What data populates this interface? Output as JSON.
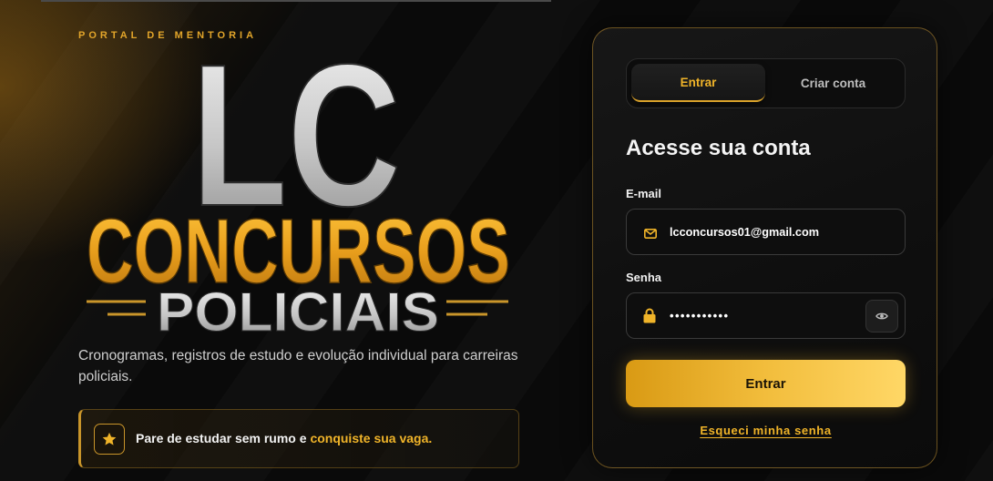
{
  "brand": {
    "eyebrow": "PORTAL DE MENTORIA",
    "logo_top": "LC",
    "logo_main": "CONCURSOS",
    "logo_sub": "POLICIAIS"
  },
  "intro": "Cronogramas, registros de estudo e evolução individual para carreiras policiais.",
  "callout": {
    "icon": "star-icon",
    "text": "Pare de estudar sem rumo e",
    "highlight": "conquiste sua vaga."
  },
  "auth": {
    "tabs": [
      {
        "label": "Entrar",
        "active": true
      },
      {
        "label": "Criar conta",
        "active": false
      }
    ],
    "heading": "Acesse sua conta",
    "email": {
      "label": "E-mail",
      "value": "lcconcursos01@gmail.com",
      "icon": "mail-icon"
    },
    "password": {
      "label": "Senha",
      "value": "•••••••••••",
      "icon": "lock-icon",
      "toggle_icon": "eye-icon"
    },
    "submit_label": "Entrar",
    "forgot_link": "Esqueci minha senha"
  },
  "colors": {
    "accent": "#f0b429",
    "accent_dark": "#d99a14",
    "accent_light": "#ffd766",
    "background": "#0a0a0a",
    "card": "#121212",
    "text_muted": "#cfcfcf"
  }
}
